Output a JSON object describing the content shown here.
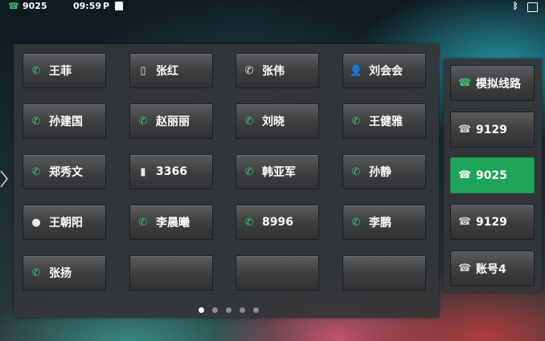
{
  "status_bar": {
    "account_number": "9025",
    "time": "09:59",
    "p_label": "P"
  },
  "grid_keys": [
    {
      "label": "王菲",
      "icon": "phone-icon",
      "icon_glyph": "✆",
      "color": "green"
    },
    {
      "label": "张红",
      "icon": "mobile-icon",
      "icon_glyph": "▯",
      "color": "white"
    },
    {
      "label": "张伟",
      "icon": "voicemail-phone-icon",
      "icon_glyph": "✆",
      "color": "white"
    },
    {
      "label": "刘会会",
      "icon": "contact-icon",
      "icon_glyph": "👤",
      "color": "white"
    },
    {
      "label": "孙建国",
      "icon": "phone-icon",
      "icon_glyph": "✆",
      "color": "green"
    },
    {
      "label": "赵丽丽",
      "icon": "phone-icon",
      "icon_glyph": "✆",
      "color": "green"
    },
    {
      "label": "刘晓",
      "icon": "phone-icon",
      "icon_glyph": "✆",
      "color": "green"
    },
    {
      "label": "王健雅",
      "icon": "phone-icon",
      "icon_glyph": "✆",
      "color": "green"
    },
    {
      "label": "郑秀文",
      "icon": "phone-icon",
      "icon_glyph": "✆",
      "color": "green"
    },
    {
      "label": "3366",
      "icon": "mobile-icon",
      "icon_glyph": "▮",
      "color": "white"
    },
    {
      "label": "韩亚军",
      "icon": "phone-icon",
      "icon_glyph": "✆",
      "color": "green"
    },
    {
      "label": "孙静",
      "icon": "phone-icon",
      "icon_glyph": "✆",
      "color": "green"
    },
    {
      "label": "王朝阳",
      "icon": "person-icon",
      "icon_glyph": "●",
      "color": "white"
    },
    {
      "label": "李晨曦",
      "icon": "phone-icon",
      "icon_glyph": "✆",
      "color": "green"
    },
    {
      "label": "8996",
      "icon": "phone-icon",
      "icon_glyph": "✆",
      "color": "green"
    },
    {
      "label": "李鹏",
      "icon": "phone-icon",
      "icon_glyph": "✆",
      "color": "green"
    },
    {
      "label": "张扬",
      "icon": "phone-icon",
      "icon_glyph": "✆",
      "color": "green"
    },
    {
      "label": "",
      "icon": "",
      "icon_glyph": "",
      "color": "white"
    },
    {
      "label": "",
      "icon": "",
      "icon_glyph": "",
      "color": "white"
    },
    {
      "label": "",
      "icon": "",
      "icon_glyph": "",
      "color": "white"
    }
  ],
  "line_keys": [
    {
      "label": "模拟线路",
      "active": false
    },
    {
      "label": "9129",
      "active": false
    },
    {
      "label": "9025",
      "active": true
    },
    {
      "label": "9129",
      "active": false
    },
    {
      "label": "账号4",
      "active": false
    }
  ],
  "pagination": {
    "pages": 5,
    "current": 1
  },
  "colors": {
    "accent_green": "#1fa55a",
    "icon_green": "#3cc66e"
  }
}
